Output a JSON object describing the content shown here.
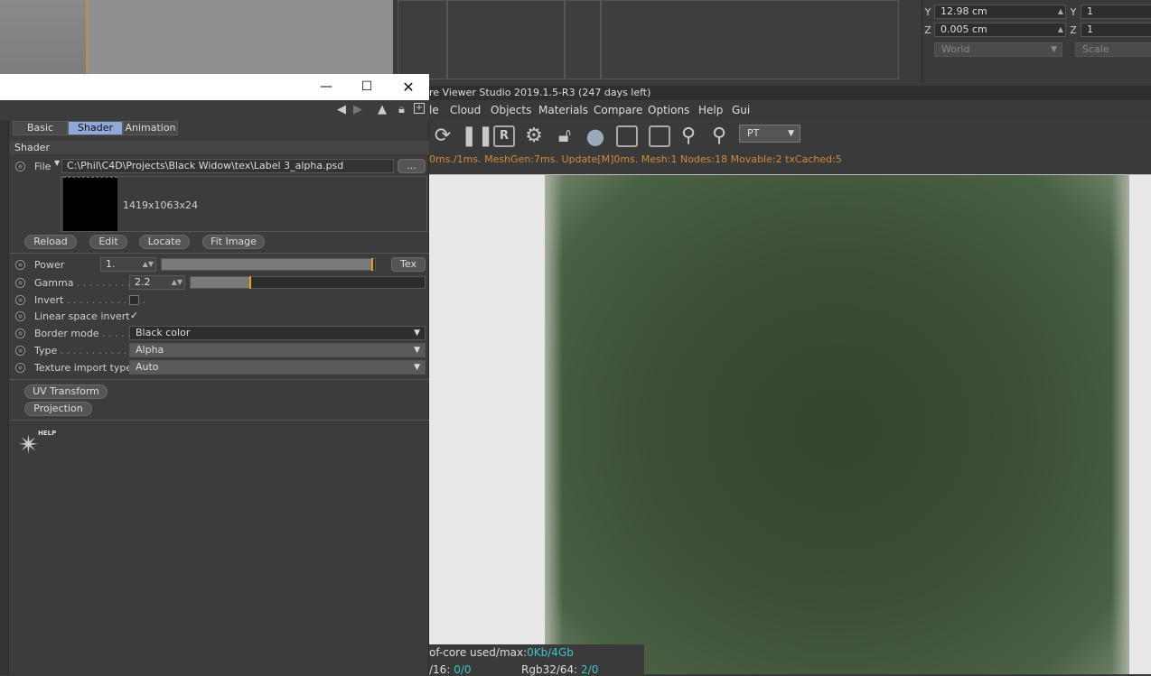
{
  "coords": {
    "row1": {
      "left_label": "Y",
      "left_value": "12.98 cm",
      "right_label": "Y",
      "right_value": "1"
    },
    "row2": {
      "left_label": "Z",
      "left_value": "0.005 cm",
      "right_label": "Z",
      "right_value": "1"
    },
    "dropdown_left": "World",
    "dropdown_right": "Scale"
  },
  "viewer": {
    "title": "re Viewer Studio 2019.1.5-R3 (247 days left)",
    "menu": [
      "le",
      "Cloud",
      "Objects",
      "Materials",
      "Compare",
      "Options",
      "Help",
      "Gui"
    ],
    "render_mode": "PT",
    "stats": "0ms./1ms. MeshGen:7ms. Update[M]0ms. Mesh:1 Nodes:18 Movable:2 txCached:5",
    "status_line1_prefix": "of-core used/max:",
    "status_line1_value": "0Kb/4Gb",
    "status_line2_prefix": "/16:",
    "status_line2_value": "0/0",
    "status_line2b_prefix": "Rgb32/64:",
    "status_line2b_value": "2/0"
  },
  "dialog": {
    "tabs": [
      "Basic",
      "Shader",
      "Animation"
    ],
    "section": "Shader",
    "file_label": "File",
    "file_path": "C:\\Phil\\C4D\\Projects\\Black Widow\\tex\\Label 3_alpha.psd",
    "browse_label": "...",
    "image_info": "1419x1063x24",
    "buttons": [
      "Reload",
      "Edit",
      "Locate",
      "Fit Image"
    ],
    "power": {
      "label": "Power",
      "value": "1.",
      "tex": "Tex",
      "level": 0.99
    },
    "gamma": {
      "label": "Gamma",
      "dots": " . . . . . . . . . .",
      "value": "2.2",
      "level": 0.26
    },
    "invert": {
      "label": "Invert",
      "dots": " . . . . . . . . . . . . ."
    },
    "linear_space_invert": {
      "label": "Linear space invert",
      "check": "✓"
    },
    "border_mode": {
      "label": "Border mode",
      "dots": " . . . . .",
      "value": "Black color"
    },
    "type": {
      "label": "Type",
      "dots": " . . . . . . . . . . . . .",
      "value": "Alpha"
    },
    "texture_import_type": {
      "label": "Texture import type",
      "value": "Auto"
    },
    "uv_transform": "UV Transform",
    "projection": "Projection",
    "help_label": "HELP"
  }
}
